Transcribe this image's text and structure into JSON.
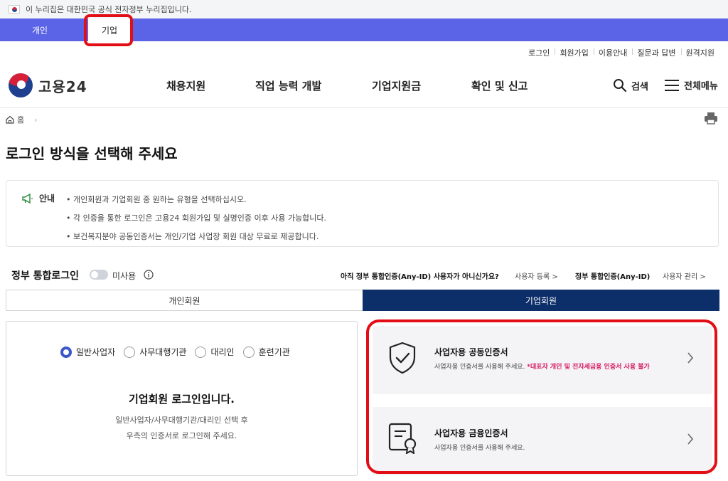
{
  "gov_bar": {
    "text": "이 누리집은 대한민국 공식 전자정부 누리집입니다."
  },
  "user_tabs": {
    "personal": "개인",
    "corporate": "기업"
  },
  "util_links": [
    "로그인",
    "회원가입",
    "이용안내",
    "질문과 답변",
    "원격지원"
  ],
  "header": {
    "logo_text": "고용24",
    "nav": [
      "채용지원",
      "직업 능력 개발",
      "기업지원금",
      "확인 및 신고"
    ],
    "search_label": "검색",
    "menu_label": "전체메뉴"
  },
  "breadcrumb": {
    "home": "홈"
  },
  "page_title": "로그인 방식을 선택해 주세요",
  "notice": {
    "label": "안내",
    "items": [
      "• 개인회원과 기업회원 중 원하는 유형을 선택하십시오.",
      "• 각 인증을 통한 로그인은 고용24 회원가입 및 실명인증 이후 사용 가능합니다.",
      "• 보건복지분야 공동인증서는 개인/기업 사업장 회원 대상 무료로 제공합니다."
    ]
  },
  "gov_login": {
    "title": "정부 통합로그인",
    "toggle_label": "미사용",
    "anyid_question": "아직 정부 통합인증(Any-ID) 사용자가 아니신가요?",
    "register_link": "사용자 등록 >",
    "anyid_label": "정부 통합인증(Any-ID)",
    "manage_link": "사용자 관리 >"
  },
  "member_tabs": {
    "personal": "개인회원",
    "corporate": "기업회원"
  },
  "left_panel": {
    "radios": [
      "일반사업자",
      "사무대행기관",
      "대리인",
      "훈련기관"
    ],
    "selected": "일반사업자",
    "title": "기업회원 로그인입니다.",
    "desc_line1": "일반사업자/사무대행기관/대리인 선택 후",
    "desc_line2": "우측의 인증서로 로그인해 주세요."
  },
  "certs": [
    {
      "title": "사업자용 공동인증서",
      "desc": "사업자용 인증서를 사용해 주세요.",
      "warning": "*대표자 개인 및 전자세금용 인증서 사용 불가",
      "icon": "shield-check-icon"
    },
    {
      "title": "사업자용 금융인증서",
      "desc": "사업자용 인증서를 사용해 주세요.",
      "warning": "",
      "icon": "certificate-icon"
    }
  ],
  "colors": {
    "tab_bar": "#5b63e6",
    "corporate_tab_active": "#0c2f69",
    "highlight": "#e30d15",
    "warning": "#d81b60"
  }
}
